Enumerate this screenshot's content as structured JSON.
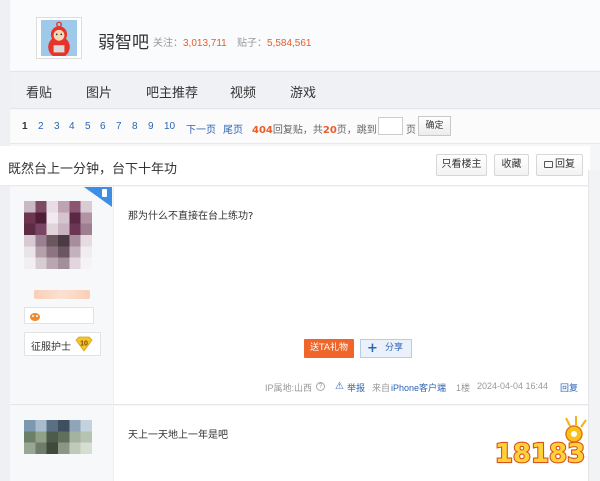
{
  "header": {
    "forum_name": "弱智吧",
    "follow_label": "关注：",
    "follow_count": "3,013,711",
    "posts_label": "贴子：",
    "posts_count": "5,584,561"
  },
  "nav": {
    "items": [
      "看贴",
      "图片",
      "吧主推荐",
      "视频",
      "游戏"
    ]
  },
  "pager": {
    "pages": [
      "1",
      "2",
      "3",
      "4",
      "5",
      "6",
      "7",
      "8",
      "9",
      "10"
    ],
    "next": "下一页",
    "last": "尾页",
    "reply_count": "404",
    "reply_label": "回复贴，共",
    "page_count": "20",
    "page_suffix": "页，",
    "jump_label": "跳到",
    "page_unit": "页",
    "confirm": "确定"
  },
  "thread": {
    "title": "既然台上一分钟，台下十年功",
    "only_op": "只看楼主",
    "favorite": "收藏",
    "reply": "回复"
  },
  "posts": [
    {
      "content": "那为什么不直接在台上练功?",
      "badge_label": "征服护士",
      "badge_level": "10",
      "gift_button": "送TA礼物",
      "share_button": "分享",
      "ip": "IP属地:山西",
      "report": "举报",
      "source": "来自",
      "client": "iPhone客户端",
      "floor": "1楼",
      "time": "2024-04-04 16:44",
      "reply": "回复"
    },
    {
      "content": "天上一天地上一年是吧"
    }
  ],
  "watermark": {
    "text": "18183"
  },
  "colors": {
    "accent_orange": "#e85c2a",
    "link_blue": "#2d64b3",
    "gift_orange": "#f0662a"
  }
}
